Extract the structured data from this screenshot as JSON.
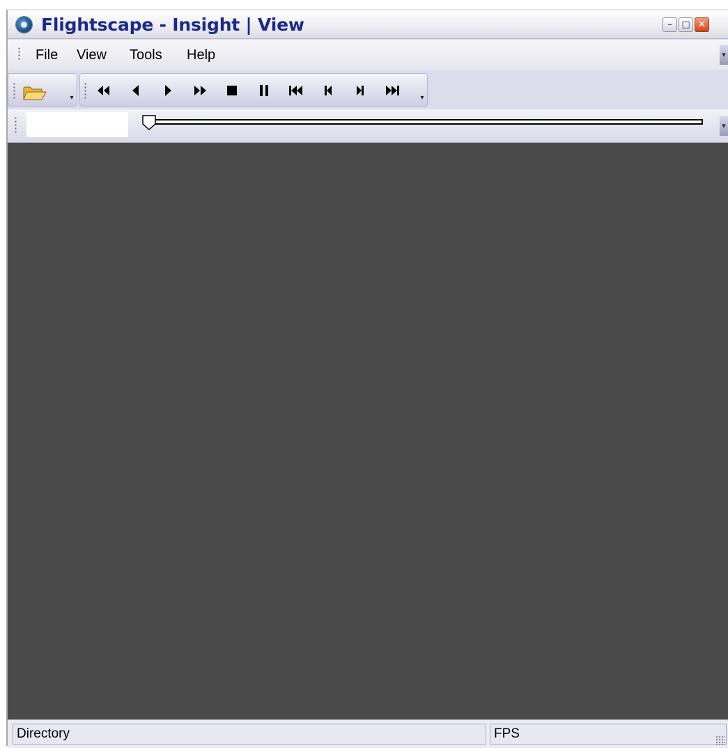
{
  "window": {
    "title": "Flightscape - Insight | View",
    "controls": {
      "minimize_icon": "minimize-icon",
      "maximize_icon": "maximize-icon",
      "close_icon": "close-icon"
    }
  },
  "menubar": {
    "items": [
      {
        "label": "File"
      },
      {
        "label": "View"
      },
      {
        "label": "Tools"
      },
      {
        "label": "Help"
      }
    ]
  },
  "toolbar": {
    "open": {
      "icon": "folder-open-icon"
    },
    "playback": [
      {
        "icon": "rewind-icon",
        "glyph": "◀◀"
      },
      {
        "icon": "step-back-icon",
        "glyph": "◀"
      },
      {
        "icon": "play-icon",
        "glyph": "▶"
      },
      {
        "icon": "fast-forward-icon",
        "glyph": "▶▶"
      },
      {
        "icon": "stop-icon",
        "glyph": "■"
      },
      {
        "icon": "pause-icon",
        "glyph": "❚❚"
      },
      {
        "icon": "skip-to-start-icon",
        "glyph": "⏮"
      },
      {
        "icon": "previous-frame-icon",
        "glyph": "⏴"
      },
      {
        "icon": "next-frame-icon",
        "glyph": "⏵"
      },
      {
        "icon": "skip-to-end-icon",
        "glyph": "⏭"
      }
    ]
  },
  "seek": {
    "time_value": "",
    "position_fraction": 0
  },
  "viewport": {
    "background": "#4a4a4a"
  },
  "statusbar": {
    "directory_label": "Directory",
    "fps_label": "FPS"
  },
  "colors": {
    "title_text": "#1a2a8c",
    "close_button": "#d2491b",
    "chrome": "#dcdcec"
  }
}
